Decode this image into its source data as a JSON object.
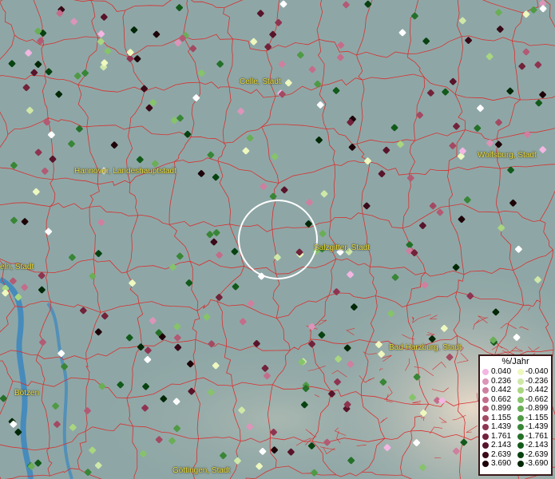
{
  "cities": [
    {
      "name": "Celle, Stadt"
    },
    {
      "name": "Wolfsburg, Stadt"
    },
    {
      "name": "Hannover, Landeshauptstadt"
    },
    {
      "name": "Salzgitter, Stadt"
    },
    {
      "name": "eln, Stadt"
    },
    {
      "name": "Bad Harzburg, Stadt"
    },
    {
      "name": "Bötzen"
    },
    {
      "name": "Göttingen, Stadt"
    }
  ],
  "legend": {
    "title": "%/Jahr",
    "positive": [
      "0.040",
      "0.236",
      "0.442",
      "0.662",
      "0.899",
      "1.155",
      "1.439",
      "1.761",
      "2.143",
      "2.639",
      "3.690"
    ],
    "negative": [
      "-0.040",
      "-0.236",
      "-0.442",
      "-0.662",
      "-0.899",
      "-1.155",
      "-1.439",
      "-1.761",
      "-2.143",
      "-2.639",
      "-3.690"
    ],
    "positive_colors": [
      "#f3b6e3",
      "#dd94b9",
      "#cf7f9f",
      "#c46d8a",
      "#b35a74",
      "#a34a63",
      "#8e3450",
      "#72223a",
      "#58142a",
      "#3a0a18",
      "#1e0408"
    ],
    "negative_colors": [
      "#eef8bf",
      "#cfe8a8",
      "#a9d67f",
      "#86c36a",
      "#6aae56",
      "#4f9a45",
      "#388636",
      "#247028",
      "#125a1a",
      "#074210",
      "#022806"
    ]
  },
  "colors": {
    "border_line": "#d83030",
    "marker_ring": "#ffffff",
    "city_label": "#f2e23a",
    "water": "#3a86c0"
  }
}
